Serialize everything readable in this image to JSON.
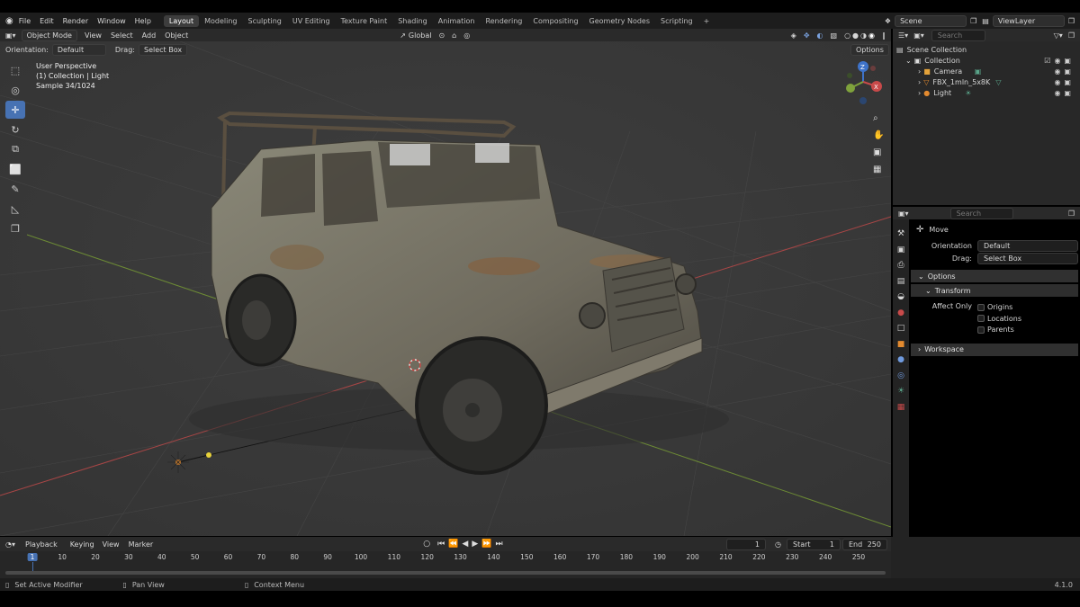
{
  "menubar": {
    "items": [
      "File",
      "Edit",
      "Render",
      "Window",
      "Help"
    ],
    "workspaces": [
      "Layout",
      "Modeling",
      "Sculpting",
      "UV Editing",
      "Texture Paint",
      "Shading",
      "Animation",
      "Rendering",
      "Compositing",
      "Geometry Nodes",
      "Scripting"
    ],
    "active_workspace": "Layout",
    "add_tab": "+",
    "scene": "Scene",
    "view_layer": "ViewLayer"
  },
  "viewport_header": {
    "mode": "Object Mode",
    "menus": [
      "View",
      "Select",
      "Add",
      "Object"
    ],
    "transform_orientation": "Global",
    "orientation_label": "Orientation:",
    "orientation_value": "Default",
    "drag_label": "Drag:",
    "drag_value": "Select Box",
    "options": "Options"
  },
  "viewport_overlay": {
    "line1": "User Perspective",
    "line2": "(1) Collection | Light",
    "line3": "Sample 34/1024"
  },
  "outliner": {
    "search_placeholder": "Search",
    "rows": [
      {
        "label": "Scene Collection",
        "indent": 0
      },
      {
        "label": "Collection",
        "indent": 1
      },
      {
        "label": "Camera",
        "indent": 2
      },
      {
        "label": "FBX_1mln_5x8K",
        "indent": 2
      },
      {
        "label": "Light",
        "indent": 2
      }
    ]
  },
  "properties": {
    "search_placeholder": "Search",
    "tool_name": "Move",
    "orientation_label": "Orientation",
    "orientation_value": "Default",
    "drag_label": "Drag:",
    "drag_value": "Select Box",
    "options_panel": "Options",
    "transform_panel": "Transform",
    "affect_only": "Affect Only",
    "origins": "Origins",
    "locations": "Locations",
    "parents": "Parents",
    "workspace_panel": "Workspace"
  },
  "timeline": {
    "menus": [
      "Playback",
      "Keying",
      "View",
      "Marker"
    ],
    "current_frame": "1",
    "start_label": "Start",
    "start_value": "1",
    "end_label": "End",
    "end_value": "250",
    "ticks": [
      "1",
      "10",
      "20",
      "30",
      "40",
      "50",
      "60",
      "70",
      "80",
      "90",
      "100",
      "110",
      "120",
      "130",
      "140",
      "150",
      "160",
      "170",
      "180",
      "190",
      "200",
      "210",
      "220",
      "230",
      "240",
      "250"
    ]
  },
  "statusbar": {
    "left": "Set Active Modifier",
    "middle": "Pan View",
    "right": "Context Menu",
    "version": "4.1.0"
  },
  "colors": {
    "accent": "#4772b3",
    "x_axis": "#c84a4a",
    "y_axis": "#7fa23c",
    "z_axis": "#3e73c9"
  }
}
